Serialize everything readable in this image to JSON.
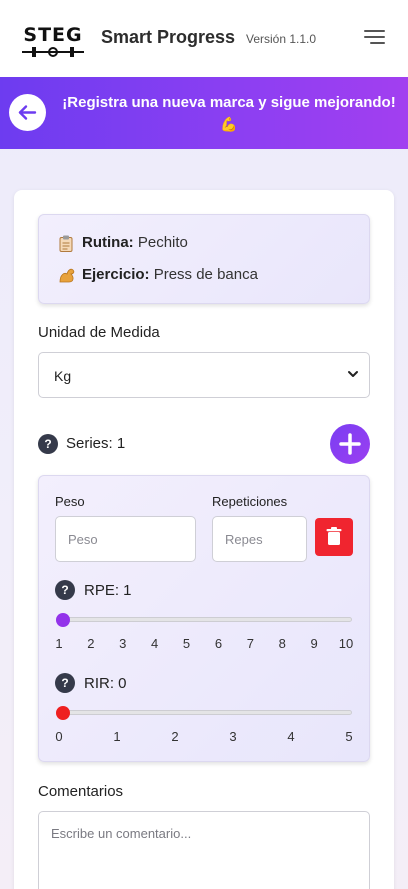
{
  "header": {
    "logo_text": "STEG",
    "title": "Smart Progress",
    "version": "Versión 1.1.0"
  },
  "banner": {
    "text": "¡Registra una nueva marca y sigue mejorando!",
    "emoji": "💪"
  },
  "info": {
    "routine_label": "Rutina:",
    "routine_value": "Pechito",
    "exercise_label": "Ejercicio:",
    "exercise_value": "Press de banca"
  },
  "unit": {
    "label": "Unidad de Medida",
    "selected": "Kg"
  },
  "series": {
    "label": "Series: 1",
    "weight_label": "Peso",
    "weight_placeholder": "Peso",
    "reps_label": "Repeticiones",
    "reps_placeholder": "Repes"
  },
  "rpe": {
    "label": "RPE: 1",
    "value": 1,
    "min": 1,
    "max": 10,
    "ticks": [
      "1",
      "2",
      "3",
      "4",
      "5",
      "6",
      "7",
      "8",
      "9",
      "10"
    ],
    "color": "#9333ea"
  },
  "rir": {
    "label": "RIR: 0",
    "value": 0,
    "min": 0,
    "max": 5,
    "ticks": [
      "0",
      "1",
      "2",
      "3",
      "4",
      "5"
    ],
    "color": "#ef2020"
  },
  "comments": {
    "label": "Comentarios",
    "placeholder": "Escribe un comentario..."
  },
  "icons": {
    "menu": "hamburger-icon",
    "back": "arrow-left-icon",
    "routine": "clipboard-icon",
    "exercise": "flexed-biceps-icon",
    "help": "question-icon",
    "add": "plus-icon",
    "delete": "trash-icon"
  }
}
